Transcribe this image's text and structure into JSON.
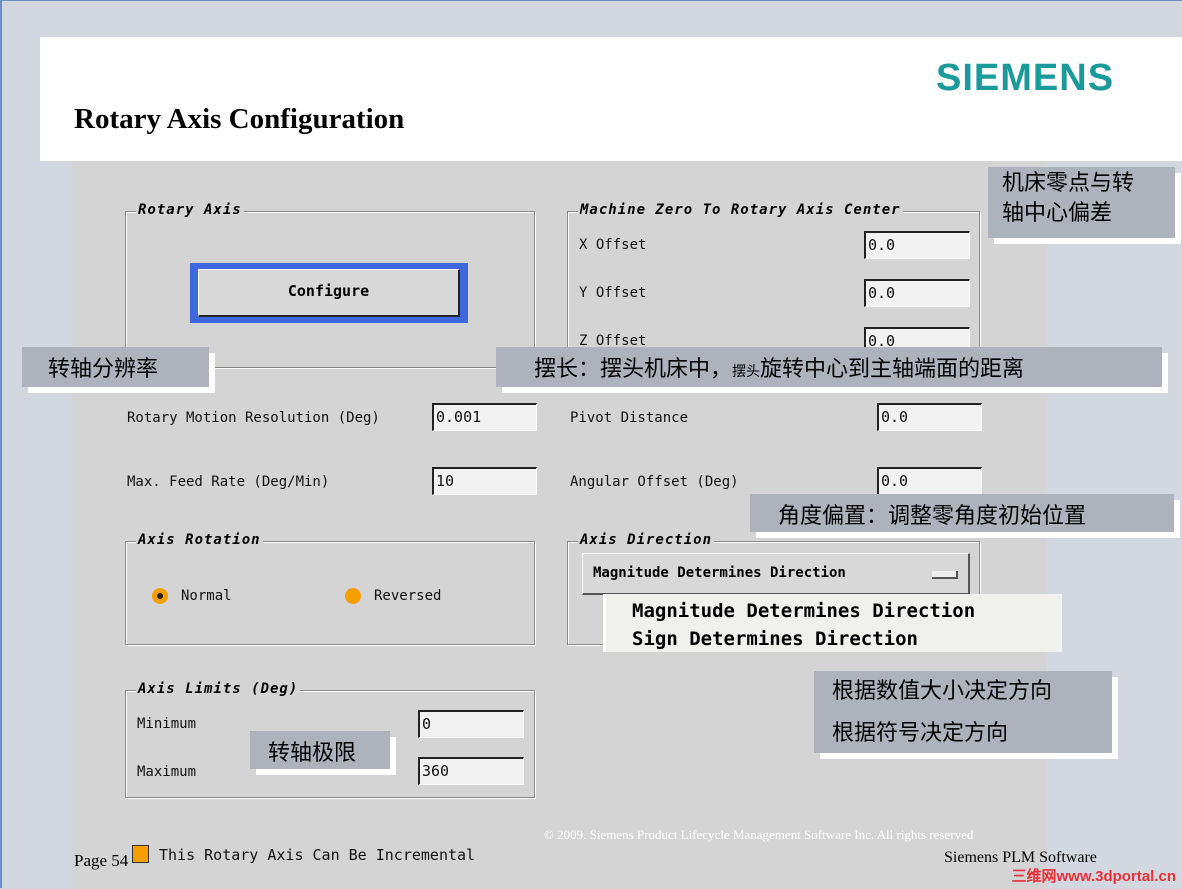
{
  "slide": {
    "title": "Rotary Axis Configuration",
    "logo": "SIEMENS",
    "page": "Page 54",
    "copyright": "© 2009. Siemens Product Lifecycle Management Software Inc. All rights reserved",
    "company": "Siemens PLM Software",
    "watermark": "三维网www.3dportal.cn"
  },
  "dialog": {
    "rotary_axis": {
      "title": "Rotary Axis",
      "configure": "Configure"
    },
    "machine_zero": {
      "title": "Machine Zero To Rotary Axis Center",
      "x_label": "X Offset",
      "x": "0.0",
      "y_label": "Y Offset",
      "y": "0.0",
      "z_label": "Z Offset",
      "z": "0.0"
    },
    "resolution": {
      "label": "Rotary Motion Resolution (Deg)",
      "value": "0.001"
    },
    "feed": {
      "label": "Max. Feed Rate (Deg/Min)",
      "value": "10"
    },
    "pivot": {
      "label": "Pivot Distance",
      "value": "0.0"
    },
    "angular": {
      "label": "Angular Offset  (Deg)",
      "value": "0.0"
    },
    "rotation": {
      "title": "Axis Rotation",
      "normal": "Normal",
      "reversed": "Reversed",
      "selected": "Normal"
    },
    "direction": {
      "title": "Axis Direction",
      "selected": "Magnitude Determines Direction",
      "options": [
        "Magnitude Determines Direction",
        "Sign Determines Direction"
      ]
    },
    "limits": {
      "title": "Axis Limits (Deg)",
      "min_label": "Minimum",
      "min": "0",
      "max_label": "Maximum",
      "max": "360"
    },
    "incremental": {
      "label": "This Rotary Axis Can Be Incremental",
      "checked": true
    }
  },
  "callouts": {
    "offset": "机床零点与转\n轴中心偏差",
    "resolution": "转轴分辨率",
    "pivot": "摆长：摆头机床中，",
    "pivot_small": "摆头",
    "pivot_rest": "旋转中心到主轴端面的距离",
    "angular": "角度偏置：调整零角度初始位置",
    "direction1": "根据数值大小决定方向",
    "direction2": "根据符号决定方向",
    "limits": "转轴极限"
  },
  "colors": {
    "accent": "#f5a000",
    "focus": "#3f67e0",
    "logo": "#1a9a9a",
    "callout": "#adb2bd"
  }
}
